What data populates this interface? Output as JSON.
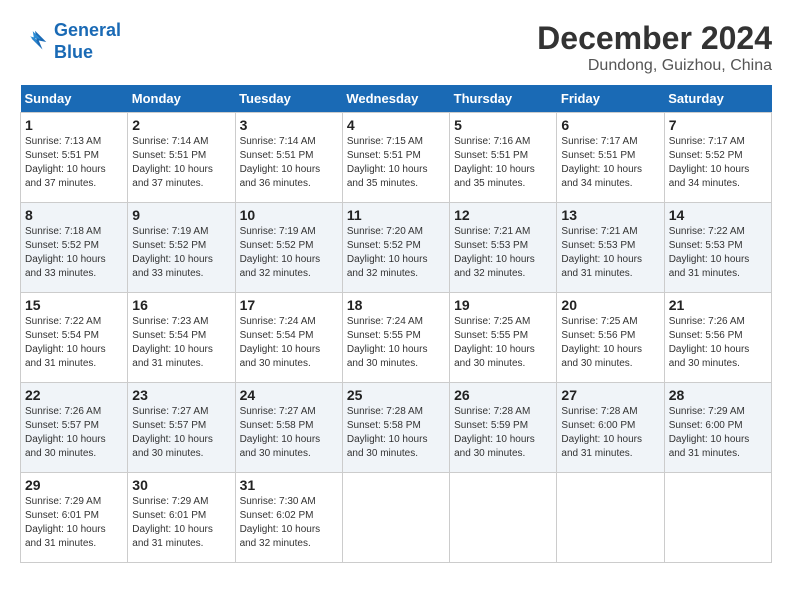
{
  "header": {
    "logo_line1": "General",
    "logo_line2": "Blue",
    "month": "December 2024",
    "location": "Dundong, Guizhou, China"
  },
  "weekdays": [
    "Sunday",
    "Monday",
    "Tuesday",
    "Wednesday",
    "Thursday",
    "Friday",
    "Saturday"
  ],
  "weeks": [
    [
      {
        "day": "1",
        "sunrise": "7:13 AM",
        "sunset": "5:51 PM",
        "daylight": "10 hours and 37 minutes."
      },
      {
        "day": "2",
        "sunrise": "7:14 AM",
        "sunset": "5:51 PM",
        "daylight": "10 hours and 37 minutes."
      },
      {
        "day": "3",
        "sunrise": "7:14 AM",
        "sunset": "5:51 PM",
        "daylight": "10 hours and 36 minutes."
      },
      {
        "day": "4",
        "sunrise": "7:15 AM",
        "sunset": "5:51 PM",
        "daylight": "10 hours and 35 minutes."
      },
      {
        "day": "5",
        "sunrise": "7:16 AM",
        "sunset": "5:51 PM",
        "daylight": "10 hours and 35 minutes."
      },
      {
        "day": "6",
        "sunrise": "7:17 AM",
        "sunset": "5:51 PM",
        "daylight": "10 hours and 34 minutes."
      },
      {
        "day": "7",
        "sunrise": "7:17 AM",
        "sunset": "5:52 PM",
        "daylight": "10 hours and 34 minutes."
      }
    ],
    [
      {
        "day": "8",
        "sunrise": "7:18 AM",
        "sunset": "5:52 PM",
        "daylight": "10 hours and 33 minutes."
      },
      {
        "day": "9",
        "sunrise": "7:19 AM",
        "sunset": "5:52 PM",
        "daylight": "10 hours and 33 minutes."
      },
      {
        "day": "10",
        "sunrise": "7:19 AM",
        "sunset": "5:52 PM",
        "daylight": "10 hours and 32 minutes."
      },
      {
        "day": "11",
        "sunrise": "7:20 AM",
        "sunset": "5:52 PM",
        "daylight": "10 hours and 32 minutes."
      },
      {
        "day": "12",
        "sunrise": "7:21 AM",
        "sunset": "5:53 PM",
        "daylight": "10 hours and 32 minutes."
      },
      {
        "day": "13",
        "sunrise": "7:21 AM",
        "sunset": "5:53 PM",
        "daylight": "10 hours and 31 minutes."
      },
      {
        "day": "14",
        "sunrise": "7:22 AM",
        "sunset": "5:53 PM",
        "daylight": "10 hours and 31 minutes."
      }
    ],
    [
      {
        "day": "15",
        "sunrise": "7:22 AM",
        "sunset": "5:54 PM",
        "daylight": "10 hours and 31 minutes."
      },
      {
        "day": "16",
        "sunrise": "7:23 AM",
        "sunset": "5:54 PM",
        "daylight": "10 hours and 31 minutes."
      },
      {
        "day": "17",
        "sunrise": "7:24 AM",
        "sunset": "5:54 PM",
        "daylight": "10 hours and 30 minutes."
      },
      {
        "day": "18",
        "sunrise": "7:24 AM",
        "sunset": "5:55 PM",
        "daylight": "10 hours and 30 minutes."
      },
      {
        "day": "19",
        "sunrise": "7:25 AM",
        "sunset": "5:55 PM",
        "daylight": "10 hours and 30 minutes."
      },
      {
        "day": "20",
        "sunrise": "7:25 AM",
        "sunset": "5:56 PM",
        "daylight": "10 hours and 30 minutes."
      },
      {
        "day": "21",
        "sunrise": "7:26 AM",
        "sunset": "5:56 PM",
        "daylight": "10 hours and 30 minutes."
      }
    ],
    [
      {
        "day": "22",
        "sunrise": "7:26 AM",
        "sunset": "5:57 PM",
        "daylight": "10 hours and 30 minutes."
      },
      {
        "day": "23",
        "sunrise": "7:27 AM",
        "sunset": "5:57 PM",
        "daylight": "10 hours and 30 minutes."
      },
      {
        "day": "24",
        "sunrise": "7:27 AM",
        "sunset": "5:58 PM",
        "daylight": "10 hours and 30 minutes."
      },
      {
        "day": "25",
        "sunrise": "7:28 AM",
        "sunset": "5:58 PM",
        "daylight": "10 hours and 30 minutes."
      },
      {
        "day": "26",
        "sunrise": "7:28 AM",
        "sunset": "5:59 PM",
        "daylight": "10 hours and 30 minutes."
      },
      {
        "day": "27",
        "sunrise": "7:28 AM",
        "sunset": "6:00 PM",
        "daylight": "10 hours and 31 minutes."
      },
      {
        "day": "28",
        "sunrise": "7:29 AM",
        "sunset": "6:00 PM",
        "daylight": "10 hours and 31 minutes."
      }
    ],
    [
      {
        "day": "29",
        "sunrise": "7:29 AM",
        "sunset": "6:01 PM",
        "daylight": "10 hours and 31 minutes."
      },
      {
        "day": "30",
        "sunrise": "7:29 AM",
        "sunset": "6:01 PM",
        "daylight": "10 hours and 31 minutes."
      },
      {
        "day": "31",
        "sunrise": "7:30 AM",
        "sunset": "6:02 PM",
        "daylight": "10 hours and 32 minutes."
      },
      null,
      null,
      null,
      null
    ]
  ]
}
